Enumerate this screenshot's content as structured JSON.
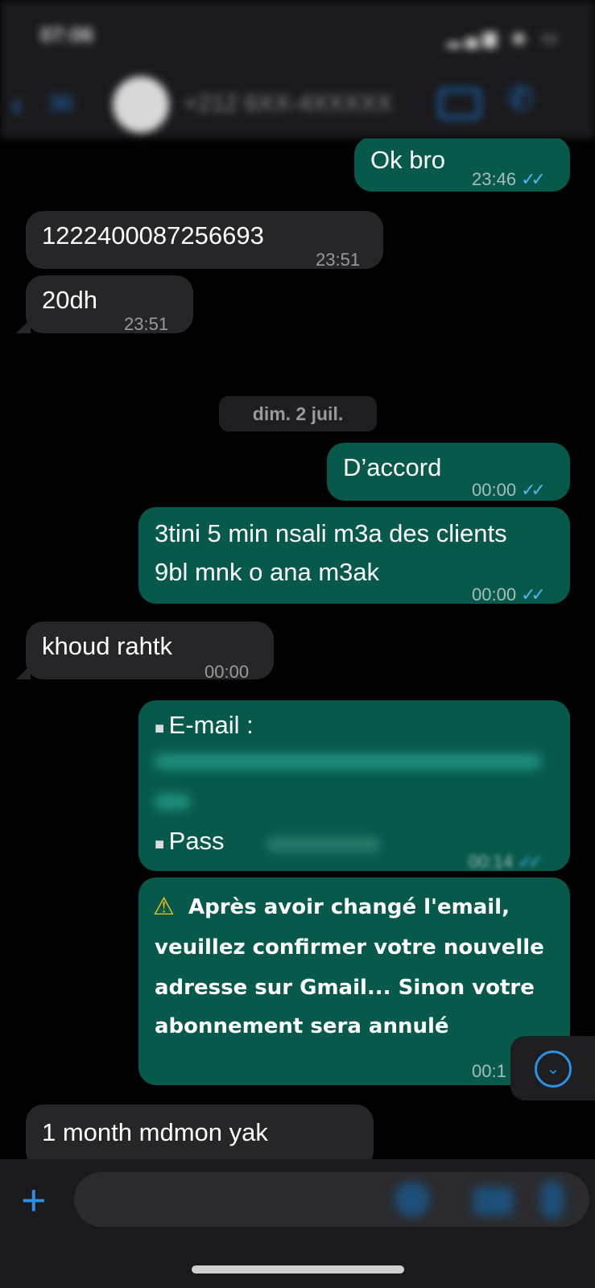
{
  "header": {
    "time": "07:06",
    "back_count": "36",
    "contact": "+212 6XX-4XXXXX"
  },
  "messages": [
    {
      "dir": "out",
      "text": "Ok bro",
      "time": "23:46",
      "ticks": "✓✓"
    },
    {
      "dir": "in",
      "text": "1222400087256693",
      "time": "23:51"
    },
    {
      "dir": "in",
      "text": "20dh",
      "time": "23:51"
    },
    {
      "dir": "out",
      "text": "D’accord",
      "time": "00:00",
      "ticks": "✓✓"
    },
    {
      "dir": "out",
      "text_line1": "3tini 5 min nsali m3a des clients",
      "text_line2": "9bl mnk o ana m3ak",
      "time": "00:00",
      "ticks": "✓✓"
    },
    {
      "dir": "in",
      "text": "khoud rahtk",
      "time": "00:00"
    },
    {
      "dir": "out",
      "email_label": "E-mail :",
      "pass_label": "Pass",
      "time": "00:14",
      "ticks": "✓✓"
    },
    {
      "dir": "out",
      "warn_line1": "Après avoir changé l'email,",
      "warn_line2": "veuillez confirmer votre nouvelle",
      "warn_line3": "adresse sur Gmail... Sinon votre",
      "warn_line4": "abonnement sera annulé",
      "time": "00:1"
    },
    {
      "dir": "in",
      "text": "1 month mdmon yak"
    }
  ],
  "date_separator": "dim. 2 juil.",
  "icons": {
    "back": "chevron-left-icon",
    "video": "video-call-icon",
    "phone": "phone-icon",
    "warning": "warning-icon",
    "scroll_down": "chevron-down-icon",
    "plus": "plus-icon",
    "sticker": "sticker-icon",
    "camera": "camera-icon",
    "mic": "microphone-icon"
  },
  "colors": {
    "outgoing": "#075a4b",
    "incoming": "#262628",
    "accent": "#2d8fe0"
  }
}
